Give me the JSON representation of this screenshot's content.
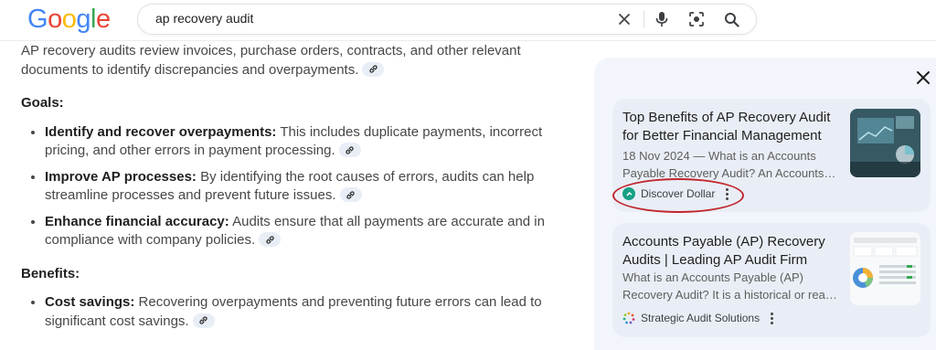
{
  "header": {
    "logo": [
      "G",
      "o",
      "o",
      "g",
      "l",
      "e"
    ],
    "logo_colors": [
      "#4285F4",
      "#EA4335",
      "#FBBC05",
      "#4285F4",
      "#34A853",
      "#EA4335"
    ],
    "query": "ap recovery audit",
    "icons": [
      "clear-icon",
      "mic-icon",
      "lens-icon",
      "search-icon"
    ]
  },
  "main": {
    "intro": "AP recovery audits review invoices, purchase orders, contracts, and other relevant documents to identify discrepancies and overpayments.",
    "goals_heading": "Goals:",
    "goals": [
      {
        "term": "Identify and recover overpayments:",
        "text": " This includes duplicate payments, incorrect pricing, and other errors in payment processing."
      },
      {
        "term": "Improve AP processes:",
        "text": " By identifying the root causes of errors, audits can help streamline processes and prevent future issues."
      },
      {
        "term": "Enhance financial accuracy:",
        "text": " Audits ensure that all payments are accurate and in compliance with company policies."
      }
    ],
    "benefits_heading": "Benefits:",
    "benefits": [
      {
        "term": "Cost savings:",
        "text": " Recovering overpayments and preventing future errors can lead to significant cost savings."
      }
    ]
  },
  "panel": {
    "cards": [
      {
        "title": "Top Benefits of AP Recovery Audit for Better Financial Management",
        "snippet_line1": "18 Nov 2024 — What is an Accounts",
        "snippet_line2": "Payable Recovery Audit? An Accounts…",
        "source": "Discover Dollar",
        "source_color": "#16a085"
      },
      {
        "title": "Accounts Payable (AP) Recovery Audits | Leading AP Audit Firm",
        "snippet_line1": "What is an Accounts Payable (AP)",
        "snippet_line2": "Recovery Audit? It is a historical or rea…",
        "source": "Strategic Audit Solutions"
      }
    ],
    "highlight_color": "#c1272d"
  }
}
